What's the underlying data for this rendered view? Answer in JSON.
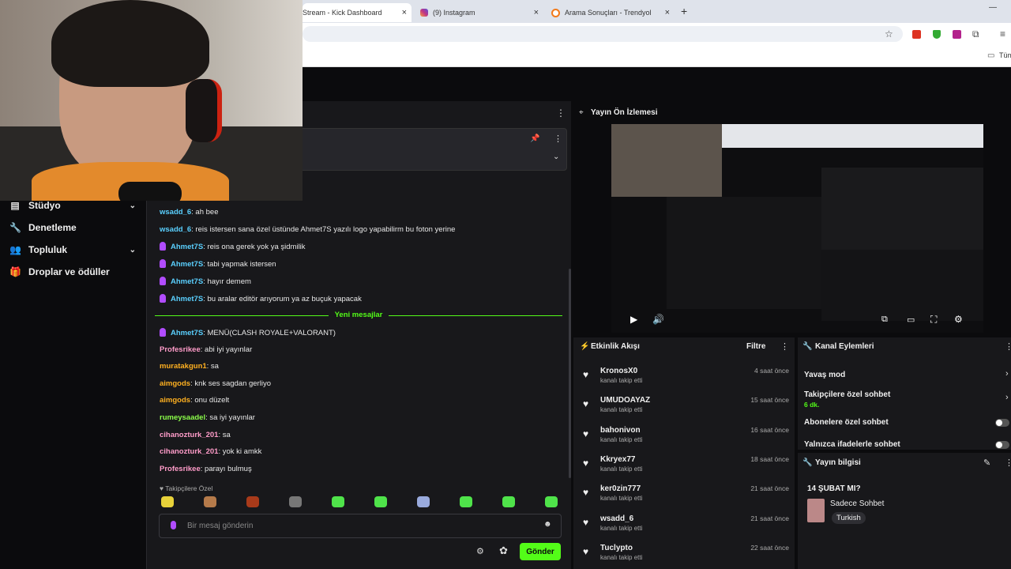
{
  "browser": {
    "tabs": [
      {
        "label": "Stream - Kick Dashboard",
        "close": "×",
        "active": true
      },
      {
        "label": "(9) Instagram",
        "close": "×"
      },
      {
        "label": "Arama Sonuçları - Trendyol",
        "close": "×"
      }
    ],
    "new_tab": "+",
    "minimize": "—",
    "bookmarks_label": "Tüm"
  },
  "sidebar": {
    "items": [
      {
        "label": "Stüdyo",
        "icon": "gamepad-icon",
        "chevron": "⌄"
      },
      {
        "label": "Denetleme",
        "icon": "wrench-icon"
      },
      {
        "label": "Topluluk",
        "icon": "people-icon",
        "chevron": "⌄"
      },
      {
        "label": "Droplar ve ödüller",
        "icon": "gift-icon"
      }
    ]
  },
  "chat": {
    "menu": "⋮",
    "messages": [
      {
        "user": "wsadd_6",
        "color": "#5ad0ff",
        "text": " ah bee",
        "badge": false
      },
      {
        "user": "wsadd_6",
        "color": "#5ad0ff",
        "text": " reis istersen sana özel üstünde Ahmet7S yazılı logo yapabilirm bu foton yerine",
        "badge": false
      },
      {
        "user": "Ahmet7S",
        "color": "#5ad0ff",
        "text": " reis ona gerek yok ya şidmilik",
        "badge": true
      },
      {
        "user": "Ahmet7S",
        "color": "#5ad0ff",
        "text": " tabi yapmak istersen",
        "badge": true
      },
      {
        "user": "Ahmet7S",
        "color": "#5ad0ff",
        "text": " hayır demem",
        "badge": true
      },
      {
        "user": "Ahmet7S",
        "color": "#5ad0ff",
        "text": " bu aralar editör arıyorum ya az buçuk yapacak",
        "badge": true
      }
    ],
    "new_messages_label": "Yeni mesajlar",
    "messages_after": [
      {
        "user": "Ahmet7S",
        "color": "#5ad0ff",
        "text": " MENÜ(CLASH ROYALE+VALORANT)",
        "badge": true
      },
      {
        "user": "Profesrikee",
        "color": "#ff9cc9",
        "text": " abi iyi yayınlar",
        "badge": false
      },
      {
        "user": "muratakgun1",
        "color": "#ffb020",
        "text": " sa",
        "badge": false
      },
      {
        "user": "aimgods",
        "color": "#ffb020",
        "text": " knk ses sagdan gerliyo",
        "badge": false
      },
      {
        "user": "aimgods",
        "color": "#ffb020",
        "text": " onu düzelt",
        "badge": false
      },
      {
        "user": "rumeysaadel",
        "color": "#8cff4a",
        "text": " sa iyi yayınlar",
        "badge": false
      },
      {
        "user": "cihanozturk_201",
        "color": "#ff9cc9",
        "text": " sa",
        "badge": false
      },
      {
        "user": "cihanozturk_201",
        "color": "#ff9cc9",
        "text": " yok ki amkk",
        "badge": false
      },
      {
        "user": "Profesrikee",
        "color": "#ff9cc9",
        "text": " parayı bulmuş",
        "badge": false
      }
    ],
    "followers_only": "♥ Takipçilere Özel",
    "input_placeholder": "Bir mesaj gönderin",
    "send_label": "Gönder"
  },
  "preview": {
    "title": "Yayın Ön İzlemesi",
    "menu": "⋮"
  },
  "activity": {
    "title": "Etkinlik Akışı",
    "filter": "Filtre",
    "menu": "⋮",
    "items": [
      {
        "name": "KronosX0",
        "sub": "kanalı takip etti",
        "time": "4 saat önce"
      },
      {
        "name": "UMUDOAYAZ",
        "sub": "kanalı takip etti",
        "time": "15 saat önce"
      },
      {
        "name": "bahonivon",
        "sub": "kanalı takip etti",
        "time": "16 saat önce"
      },
      {
        "name": "Kkryex77",
        "sub": "kanalı takip etti",
        "time": "18 saat önce"
      },
      {
        "name": "ker0zin777",
        "sub": "kanalı takip etti",
        "time": "21 saat önce"
      },
      {
        "name": "wsadd_6",
        "sub": "kanalı takip etti",
        "time": "21 saat önce"
      },
      {
        "name": "Tuclypto",
        "sub": "kanalı takip etti",
        "time": "22 saat önce"
      }
    ]
  },
  "channel_actions": {
    "title": "Kanal Eylemleri",
    "menu": "⋮",
    "slow_mode": "Yavaş mod",
    "followers_chat": "Takipçilere özel sohbet",
    "followers_chat_value": "6 dk.",
    "subs_chat": "Abonelere özel sohbet",
    "emotes_chat": "Yalnızca ifadelerle sohbet"
  },
  "stream_info": {
    "title": "Yayın bilgisi",
    "menu": "⋮",
    "stream_title": "14 ŞUBAT MI?",
    "category": "Sadece Sohbet",
    "language": "Turkish"
  },
  "colors": {
    "accent": "#53fc18",
    "panel": "#18181b",
    "background": "#0b0b0d"
  }
}
